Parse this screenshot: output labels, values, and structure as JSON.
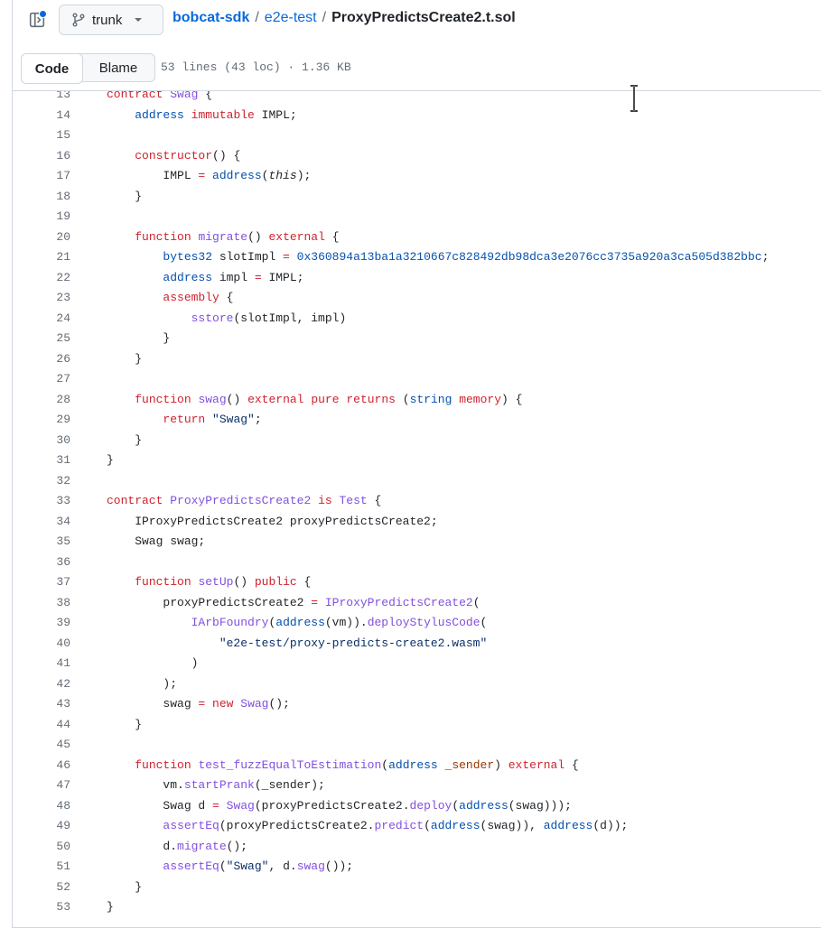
{
  "header": {
    "branch": "trunk",
    "breadcrumb": {
      "repo": "bobcat-sdk",
      "folder": "e2e-test",
      "file": "ProxyPredictsCreate2.t.sol",
      "separator": "/"
    }
  },
  "tabs": {
    "code": "Code",
    "blame": "Blame"
  },
  "file_info": "53 lines (43 loc) · 1.36 KB",
  "code": {
    "lines": [
      {
        "num": "13",
        "tokens": [
          {
            "t": "contract ",
            "c": "k"
          },
          {
            "t": "Swag",
            "c": "f"
          },
          {
            "t": " {",
            "c": ""
          }
        ]
      },
      {
        "num": "14",
        "tokens": [
          {
            "t": "    ",
            "c": ""
          },
          {
            "t": "address",
            "c": "t"
          },
          {
            "t": " ",
            "c": ""
          },
          {
            "t": "immutable",
            "c": "k"
          },
          {
            "t": " IMPL;",
            "c": ""
          }
        ]
      },
      {
        "num": "15",
        "tokens": []
      },
      {
        "num": "16",
        "tokens": [
          {
            "t": "    ",
            "c": ""
          },
          {
            "t": "constructor",
            "c": "k"
          },
          {
            "t": "() {",
            "c": ""
          }
        ]
      },
      {
        "num": "17",
        "tokens": [
          {
            "t": "        IMPL ",
            "c": ""
          },
          {
            "t": "=",
            "c": "k"
          },
          {
            "t": " ",
            "c": ""
          },
          {
            "t": "address",
            "c": "t"
          },
          {
            "t": "(",
            "c": ""
          },
          {
            "t": "this",
            "c": "i"
          },
          {
            "t": ");",
            "c": ""
          }
        ]
      },
      {
        "num": "18",
        "tokens": [
          {
            "t": "    }",
            "c": ""
          }
        ]
      },
      {
        "num": "19",
        "tokens": []
      },
      {
        "num": "20",
        "tokens": [
          {
            "t": "    ",
            "c": ""
          },
          {
            "t": "function",
            "c": "k"
          },
          {
            "t": " ",
            "c": ""
          },
          {
            "t": "migrate",
            "c": "f"
          },
          {
            "t": "() ",
            "c": ""
          },
          {
            "t": "external",
            "c": "k"
          },
          {
            "t": " {",
            "c": ""
          }
        ]
      },
      {
        "num": "21",
        "tokens": [
          {
            "t": "        ",
            "c": ""
          },
          {
            "t": "bytes32",
            "c": "t"
          },
          {
            "t": " slotImpl ",
            "c": ""
          },
          {
            "t": "=",
            "c": "k"
          },
          {
            "t": " ",
            "c": ""
          },
          {
            "t": "0x360894a13ba1a3210667c828492db98dca3e2076cc3735a920a3ca505d382bbc",
            "c": "n"
          },
          {
            "t": ";",
            "c": ""
          }
        ]
      },
      {
        "num": "22",
        "tokens": [
          {
            "t": "        ",
            "c": ""
          },
          {
            "t": "address",
            "c": "t"
          },
          {
            "t": " impl ",
            "c": ""
          },
          {
            "t": "=",
            "c": "k"
          },
          {
            "t": " IMPL;",
            "c": ""
          }
        ]
      },
      {
        "num": "23",
        "tokens": [
          {
            "t": "        ",
            "c": ""
          },
          {
            "t": "assembly",
            "c": "k"
          },
          {
            "t": " {",
            "c": ""
          }
        ]
      },
      {
        "num": "24",
        "tokens": [
          {
            "t": "            ",
            "c": ""
          },
          {
            "t": "sstore",
            "c": "f"
          },
          {
            "t": "(slotImpl, impl)",
            "c": ""
          }
        ]
      },
      {
        "num": "25",
        "tokens": [
          {
            "t": "        }",
            "c": ""
          }
        ]
      },
      {
        "num": "26",
        "tokens": [
          {
            "t": "    }",
            "c": ""
          }
        ]
      },
      {
        "num": "27",
        "tokens": []
      },
      {
        "num": "28",
        "tokens": [
          {
            "t": "    ",
            "c": ""
          },
          {
            "t": "function",
            "c": "k"
          },
          {
            "t": " ",
            "c": ""
          },
          {
            "t": "swag",
            "c": "f"
          },
          {
            "t": "() ",
            "c": ""
          },
          {
            "t": "external",
            "c": "k"
          },
          {
            "t": " ",
            "c": ""
          },
          {
            "t": "pure",
            "c": "k"
          },
          {
            "t": " ",
            "c": ""
          },
          {
            "t": "returns",
            "c": "k"
          },
          {
            "t": " (",
            "c": ""
          },
          {
            "t": "string",
            "c": "t"
          },
          {
            "t": " ",
            "c": ""
          },
          {
            "t": "memory",
            "c": "k"
          },
          {
            "t": ") {",
            "c": ""
          }
        ]
      },
      {
        "num": "29",
        "tokens": [
          {
            "t": "        ",
            "c": ""
          },
          {
            "t": "return",
            "c": "k"
          },
          {
            "t": " ",
            "c": ""
          },
          {
            "t": "\"Swag\"",
            "c": "s"
          },
          {
            "t": ";",
            "c": ""
          }
        ]
      },
      {
        "num": "30",
        "tokens": [
          {
            "t": "    }",
            "c": ""
          }
        ]
      },
      {
        "num": "31",
        "tokens": [
          {
            "t": "}",
            "c": ""
          }
        ]
      },
      {
        "num": "32",
        "tokens": []
      },
      {
        "num": "33",
        "tokens": [
          {
            "t": "contract ",
            "c": "k"
          },
          {
            "t": "ProxyPredictsCreate2",
            "c": "f"
          },
          {
            "t": " ",
            "c": ""
          },
          {
            "t": "is",
            "c": "k"
          },
          {
            "t": " ",
            "c": ""
          },
          {
            "t": "Test",
            "c": "f"
          },
          {
            "t": " {",
            "c": ""
          }
        ]
      },
      {
        "num": "34",
        "tokens": [
          {
            "t": "    IProxyPredictsCreate2 proxyPredictsCreate2;",
            "c": ""
          }
        ]
      },
      {
        "num": "35",
        "tokens": [
          {
            "t": "    Swag swag;",
            "c": ""
          }
        ]
      },
      {
        "num": "36",
        "tokens": []
      },
      {
        "num": "37",
        "tokens": [
          {
            "t": "    ",
            "c": ""
          },
          {
            "t": "function",
            "c": "k"
          },
          {
            "t": " ",
            "c": ""
          },
          {
            "t": "setUp",
            "c": "f"
          },
          {
            "t": "() ",
            "c": ""
          },
          {
            "t": "public",
            "c": "k"
          },
          {
            "t": " {",
            "c": ""
          }
        ]
      },
      {
        "num": "38",
        "tokens": [
          {
            "t": "        proxyPredictsCreate2 ",
            "c": ""
          },
          {
            "t": "=",
            "c": "k"
          },
          {
            "t": " ",
            "c": ""
          },
          {
            "t": "IProxyPredictsCreate2",
            "c": "f"
          },
          {
            "t": "(",
            "c": ""
          }
        ]
      },
      {
        "num": "39",
        "tokens": [
          {
            "t": "            ",
            "c": ""
          },
          {
            "t": "IArbFoundry",
            "c": "f"
          },
          {
            "t": "(",
            "c": ""
          },
          {
            "t": "address",
            "c": "t"
          },
          {
            "t": "(vm)).",
            "c": ""
          },
          {
            "t": "deployStylusCode",
            "c": "f"
          },
          {
            "t": "(",
            "c": ""
          }
        ]
      },
      {
        "num": "40",
        "tokens": [
          {
            "t": "                ",
            "c": ""
          },
          {
            "t": "\"e2e-test/proxy-predicts-create2.wasm\"",
            "c": "s"
          }
        ]
      },
      {
        "num": "41",
        "tokens": [
          {
            "t": "            )",
            "c": ""
          }
        ]
      },
      {
        "num": "42",
        "tokens": [
          {
            "t": "        );",
            "c": ""
          }
        ]
      },
      {
        "num": "43",
        "tokens": [
          {
            "t": "        swag ",
            "c": ""
          },
          {
            "t": "=",
            "c": "k"
          },
          {
            "t": " ",
            "c": ""
          },
          {
            "t": "new",
            "c": "k"
          },
          {
            "t": " ",
            "c": ""
          },
          {
            "t": "Swag",
            "c": "f"
          },
          {
            "t": "();",
            "c": ""
          }
        ]
      },
      {
        "num": "44",
        "tokens": [
          {
            "t": "    }",
            "c": ""
          }
        ]
      },
      {
        "num": "45",
        "tokens": []
      },
      {
        "num": "46",
        "tokens": [
          {
            "t": "    ",
            "c": ""
          },
          {
            "t": "function",
            "c": "k"
          },
          {
            "t": " ",
            "c": ""
          },
          {
            "t": "test_fuzzEqualToEstimation",
            "c": "f"
          },
          {
            "t": "(",
            "c": ""
          },
          {
            "t": "address",
            "c": "t"
          },
          {
            "t": " ",
            "c": ""
          },
          {
            "t": "_sender",
            "c": "v"
          },
          {
            "t": ") ",
            "c": ""
          },
          {
            "t": "external",
            "c": "k"
          },
          {
            "t": " {",
            "c": ""
          }
        ]
      },
      {
        "num": "47",
        "tokens": [
          {
            "t": "        vm.",
            "c": ""
          },
          {
            "t": "startPrank",
            "c": "f"
          },
          {
            "t": "(_sender);",
            "c": ""
          }
        ]
      },
      {
        "num": "48",
        "tokens": [
          {
            "t": "        Swag d ",
            "c": ""
          },
          {
            "t": "=",
            "c": "k"
          },
          {
            "t": " ",
            "c": ""
          },
          {
            "t": "Swag",
            "c": "f"
          },
          {
            "t": "(proxyPredictsCreate2.",
            "c": ""
          },
          {
            "t": "deploy",
            "c": "f"
          },
          {
            "t": "(",
            "c": ""
          },
          {
            "t": "address",
            "c": "t"
          },
          {
            "t": "(swag)));",
            "c": ""
          }
        ]
      },
      {
        "num": "49",
        "tokens": [
          {
            "t": "        ",
            "c": ""
          },
          {
            "t": "assertEq",
            "c": "f"
          },
          {
            "t": "(proxyPredictsCreate2.",
            "c": ""
          },
          {
            "t": "predict",
            "c": "f"
          },
          {
            "t": "(",
            "c": ""
          },
          {
            "t": "address",
            "c": "t"
          },
          {
            "t": "(swag)), ",
            "c": ""
          },
          {
            "t": "address",
            "c": "t"
          },
          {
            "t": "(d));",
            "c": ""
          }
        ]
      },
      {
        "num": "50",
        "tokens": [
          {
            "t": "        d.",
            "c": ""
          },
          {
            "t": "migrate",
            "c": "f"
          },
          {
            "t": "();",
            "c": ""
          }
        ]
      },
      {
        "num": "51",
        "tokens": [
          {
            "t": "        ",
            "c": ""
          },
          {
            "t": "assertEq",
            "c": "f"
          },
          {
            "t": "(",
            "c": ""
          },
          {
            "t": "\"Swag\"",
            "c": "s"
          },
          {
            "t": ", d.",
            "c": ""
          },
          {
            "t": "swag",
            "c": "f"
          },
          {
            "t": "());",
            "c": ""
          }
        ]
      },
      {
        "num": "52",
        "tokens": [
          {
            "t": "    }",
            "c": ""
          }
        ]
      },
      {
        "num": "53",
        "tokens": [
          {
            "t": "}",
            "c": ""
          }
        ]
      }
    ]
  }
}
